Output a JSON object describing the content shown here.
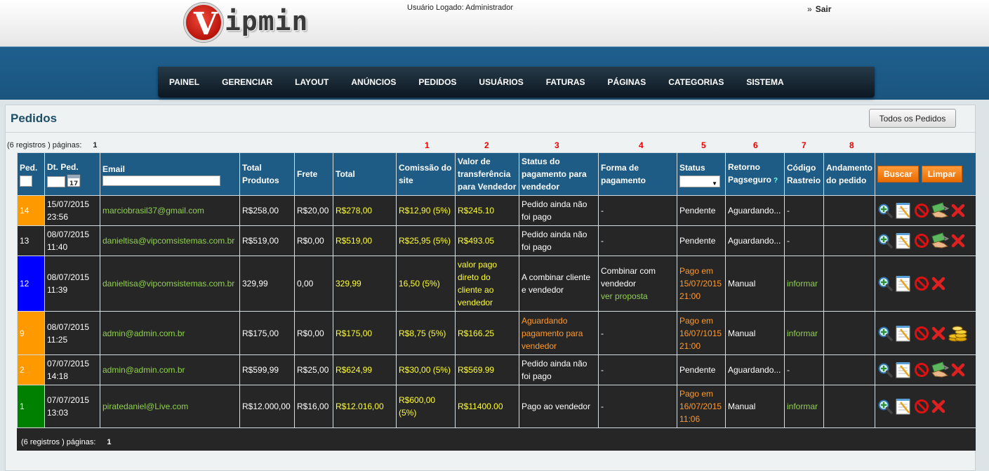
{
  "header": {
    "logo_letter": "V",
    "logo_text": "ipmin",
    "user_logged": "Usuário Logado: Administrador",
    "logout_arrow": "»",
    "logout_label": "Sair"
  },
  "nav": [
    "PAINEL",
    "GERENCIAR",
    "LAYOUT",
    "ANÚNCIOS",
    "PEDIDOS",
    "USUÁRIOS",
    "FATURAS",
    "PÁGINAS",
    "CATEGORIAS",
    "SISTEMA"
  ],
  "page": {
    "title": "Pedidos",
    "all_orders_button": "Todos os Pedidos",
    "pagination_label": "(6 registros ) páginas:",
    "pagination_page": "1"
  },
  "column_numbers": [
    "1",
    "2",
    "3",
    "4",
    "5",
    "6",
    "7",
    "8"
  ],
  "table": {
    "headers": {
      "ped": "Ped.",
      "dt_ped": "Dt. Ped.",
      "calendar_day": "17",
      "email": "Email",
      "total_produtos": "Total Produtos",
      "frete": "Frete",
      "total": "Total",
      "comissao": "Comissão do site",
      "valor_transf": "Valor de transferência para Vendedor",
      "status_pag": "Status do pagamento para vendedor",
      "forma_pag": "Forma de pagamento",
      "status": "Status",
      "retorno": "Retorno Pagseguro",
      "retorno_help": "?",
      "codigo": "Código Rastreio",
      "andamento": "Andamento do pedido",
      "buscar": "Buscar",
      "limpar": "Limpar"
    },
    "rows": [
      {
        "ped": "14",
        "ped_color": "#ff9900",
        "date": "15/07/2015",
        "time": "23:56",
        "email": "marciobrasil37@gmail.com",
        "total_produtos": "R$258,00",
        "frete": "R$20,00",
        "total": "R$278,00",
        "comissao": "R$12,90 (5%)",
        "valor": "R$245.10",
        "status_pag": "Pedido ainda não foi pago",
        "forma": "-",
        "forma_link": "",
        "status": "Pendente",
        "retorno": "Aguardando...",
        "codigo": "-",
        "andamento": ""
      },
      {
        "ped": "13",
        "ped_color": "#262626",
        "date": "08/07/2015",
        "time": "11:40",
        "email": "danieltisa@vipcomsistemas.com.br",
        "total_produtos": "R$519,00",
        "frete": "R$0,00",
        "total": "R$519,00",
        "comissao": "R$25,95 (5%)",
        "valor": "R$493.05",
        "status_pag": "Pedido ainda não foi pago",
        "forma": "-",
        "forma_link": "",
        "status": "Pendente",
        "retorno": "Aguardando...",
        "codigo": "-",
        "andamento": ""
      },
      {
        "ped": "12",
        "ped_color": "#0000ff",
        "date": "08/07/2015",
        "time": "11:39",
        "email": "danieltisa@vipcomsistemas.com.br",
        "total_produtos": "329,99",
        "frete": "0,00",
        "total": "329,99",
        "comissao": "16,50 (5%)",
        "valor": "valor pago direto do cliente ao vendedor",
        "status_pag": "A combinar cliente e vendedor",
        "forma": "Combinar com vendedor",
        "forma_link": "ver proposta",
        "status": "Pago em 15/07/2015 21:00",
        "retorno": "Manual",
        "codigo": "informar",
        "andamento": ""
      },
      {
        "ped": "9",
        "ped_color": "#ff9900",
        "date": "08/07/2015",
        "time": "11:25",
        "email": "admin@admin.com.br",
        "total_produtos": "R$175,00",
        "frete": "R$0,00",
        "total": "R$175,00",
        "comissao": "R$8,75 (5%)",
        "valor": "R$166.25",
        "status_pag": "Aguardando pagamento para vendedor",
        "forma": "-",
        "forma_link": "",
        "status": "Pago em 16/07/1015 21:00",
        "retorno": "Manual",
        "codigo": "informar",
        "andamento": ""
      },
      {
        "ped": "2",
        "ped_color": "#ff9900",
        "date": "07/07/2015",
        "time": "14:18",
        "email": "admin@admin.com.br",
        "total_produtos": "R$599,99",
        "frete": "R$25,00",
        "total": "R$624,99",
        "comissao": "R$30,00 (5%)",
        "valor": "R$569.99",
        "status_pag": "Pedido ainda não foi pago",
        "forma": "-",
        "forma_link": "",
        "status": "Pendente",
        "retorno": "Aguardando...",
        "codigo": "-",
        "andamento": ""
      },
      {
        "ped": "1",
        "ped_color": "#008000",
        "date": "07/07/2015",
        "time": "13:03",
        "email": "piratedaniel@Live.com",
        "total_produtos": "R$12.000,00",
        "frete": "R$16,00",
        "total": "R$12.016,00",
        "comissao": "R$600,00 (5%)",
        "valor": "R$11400.00",
        "status_pag": "Pago ao vendedor",
        "forma": "-",
        "forma_link": "",
        "status": "Pago em 16/07/2015 11:06",
        "retorno": "Manual",
        "codigo": "informar",
        "andamento": ""
      }
    ]
  }
}
